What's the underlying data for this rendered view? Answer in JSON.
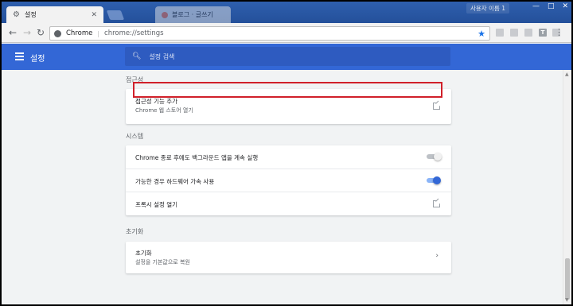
{
  "tabs": [
    {
      "title": "설정",
      "active": true
    },
    {
      "title": "블로그 · 글쓰기",
      "active": false
    }
  ],
  "window": {
    "user_label": "사용자 이름 1",
    "minimize": "—",
    "maximize": "□",
    "close": "✕"
  },
  "toolbar": {
    "back": "←",
    "forward": "→",
    "reload": "↻",
    "site_chip": "Chrome",
    "url": "chrome://settings",
    "star": "★",
    "extensions": [
      "",
      "",
      "",
      "T",
      ""
    ],
    "menu": "⋮"
  },
  "header": {
    "title": "설정",
    "search_placeholder": "설정 검색",
    "accent_color": "#3367d6"
  },
  "sections": [
    {
      "heading": "접근성",
      "rows": [
        {
          "label": "접근성 기능 추가",
          "sub": "Chrome 웹 스토어 열기",
          "control": "external-link"
        }
      ]
    },
    {
      "heading": "시스템",
      "rows": [
        {
          "label": "Chrome 종료 후에도 백그라운드 앱을 계속 실행",
          "control": "toggle",
          "checked": false,
          "highlighted": true
        },
        {
          "label": "가능한 경우 하드웨어 가속 사용",
          "control": "toggle",
          "checked": true
        },
        {
          "label": "프록시 설정 열기",
          "control": "external-link"
        }
      ]
    },
    {
      "heading": "초기화",
      "rows": [
        {
          "label": "초기화",
          "sub": "설정을 기본값으로 복원",
          "control": "chevron"
        }
      ]
    }
  ],
  "highlight_color": "#d0202a"
}
